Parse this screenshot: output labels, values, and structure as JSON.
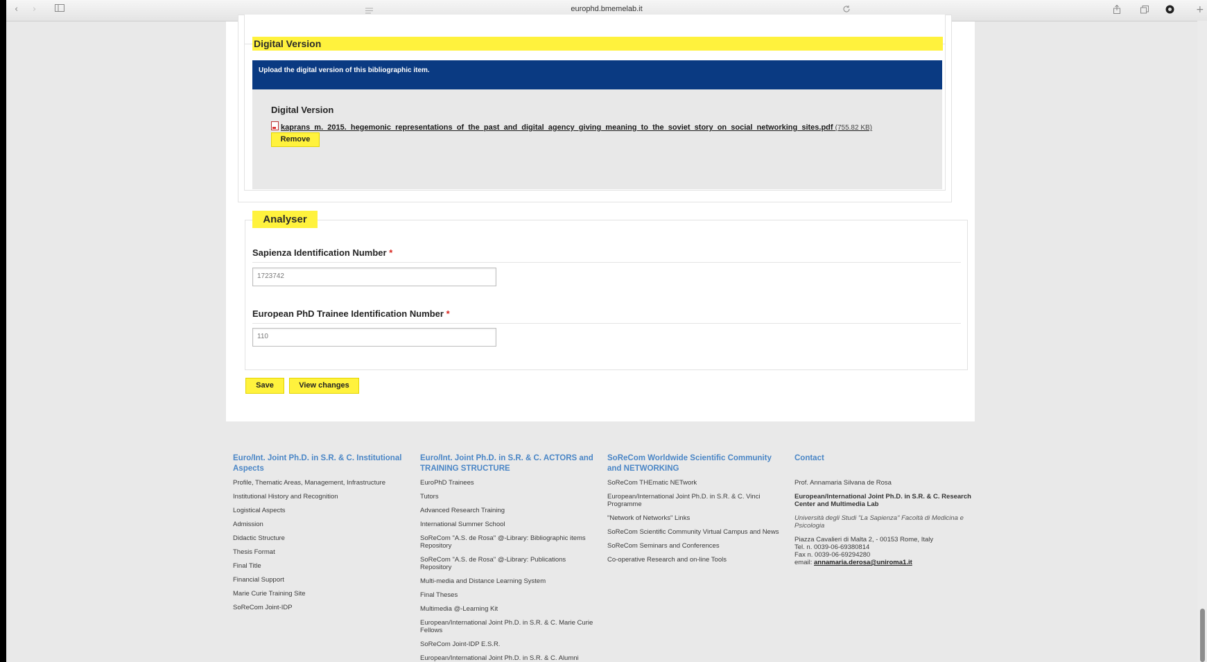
{
  "browser": {
    "url": "europhd.bmemelab.it"
  },
  "digital_version": {
    "legend": "Digital Version",
    "banner": "Upload the digital version of this bibliographic item.",
    "field_label": "Digital Version",
    "file_name": "kaprans_m._2015._hegemonic_representations_of_the_past_and_digital_agency_giving_meaning_to_the_soviet_story_on_social_networking_sites.pdf",
    "file_size": "(755.82 KB)",
    "remove_label": "Remove"
  },
  "analyser": {
    "legend": "Analyser",
    "sapienza_label": "Sapienza Identification Number",
    "sapienza_value": "1723742",
    "europhd_label": "European PhD Trainee Identification Number",
    "europhd_value": "110",
    "required_mark": "*"
  },
  "actions": {
    "save_label": "Save",
    "view_changes_label": "View changes"
  },
  "footer": {
    "col1": {
      "heading": "Euro/Int. Joint Ph.D. in S.R. & C. Institutional Aspects",
      "links": [
        "Profile, Thematic Areas, Management, Infrastructure",
        "Institutional History and Recognition",
        "Logistical Aspects",
        "Admission",
        "Didactic Structure",
        "Thesis Format",
        "Final Title",
        "Financial Support",
        "Marie Curie Training Site",
        "SoReCom Joint-IDP"
      ]
    },
    "col2": {
      "heading": "Euro/Int. Joint Ph.D. in S.R. & C. ACTORS and TRAINING STRUCTURE",
      "links": [
        "EuroPhD Trainees",
        "Tutors",
        "Advanced Research Training",
        "International Summer School",
        "SoReCom \"A.S. de Rosa\" @-Library: Bibliographic items Repository",
        "SoReCom \"A.S. de Rosa\" @-Library: Publications Repository",
        "Multi-media and Distance Learning System",
        "Final Theses",
        "Multimedia @-Learning Kit",
        "European/International Joint Ph.D. in S.R. & C. Marie Curie Fellows",
        "SoReCom Joint-IDP E.S.R.",
        "European/International Joint Ph.D. in S.R. & C. Alumni"
      ]
    },
    "col3": {
      "heading": "SoReCom Worldwide Scientific Community and NETWORKING",
      "links": [
        "SoReCom THEmatic NETwork",
        "European/International Joint Ph.D. in S.R. & C. Vinci Programme",
        "\"Network of Networks\" Links",
        "SoReCom Scientific Community Virtual Campus and News",
        "SoReCom Seminars and Conferences",
        "Co-operative Research and on-line Tools"
      ]
    },
    "col4": {
      "heading": "Contact",
      "name": "Prof. Annamaria Silvana de Rosa",
      "center": "European/International Joint Ph.D. in S.R. & C. Research Center and Multimedia Lab",
      "university": "Università degli Studi \"La Sapienza\" Facoltà di Medicina e Psicologia",
      "address": "Piazza Cavalieri di Malta 2, - 00153 Rome, Italy",
      "tel": "Tel. n. 0039-06-69380814",
      "fax": "Fax n. 0039-06-69294280",
      "email_prefix": "email:",
      "email": "annamaria.derosa@uniroma1.it"
    }
  },
  "icons": [
    "back-icon",
    "forward-icon",
    "sidebar-icon",
    "reader-icon",
    "reload-icon",
    "share-icon",
    "tabs-icon",
    "extension-icon",
    "new-tab-icon",
    "pdf-file-icon"
  ]
}
